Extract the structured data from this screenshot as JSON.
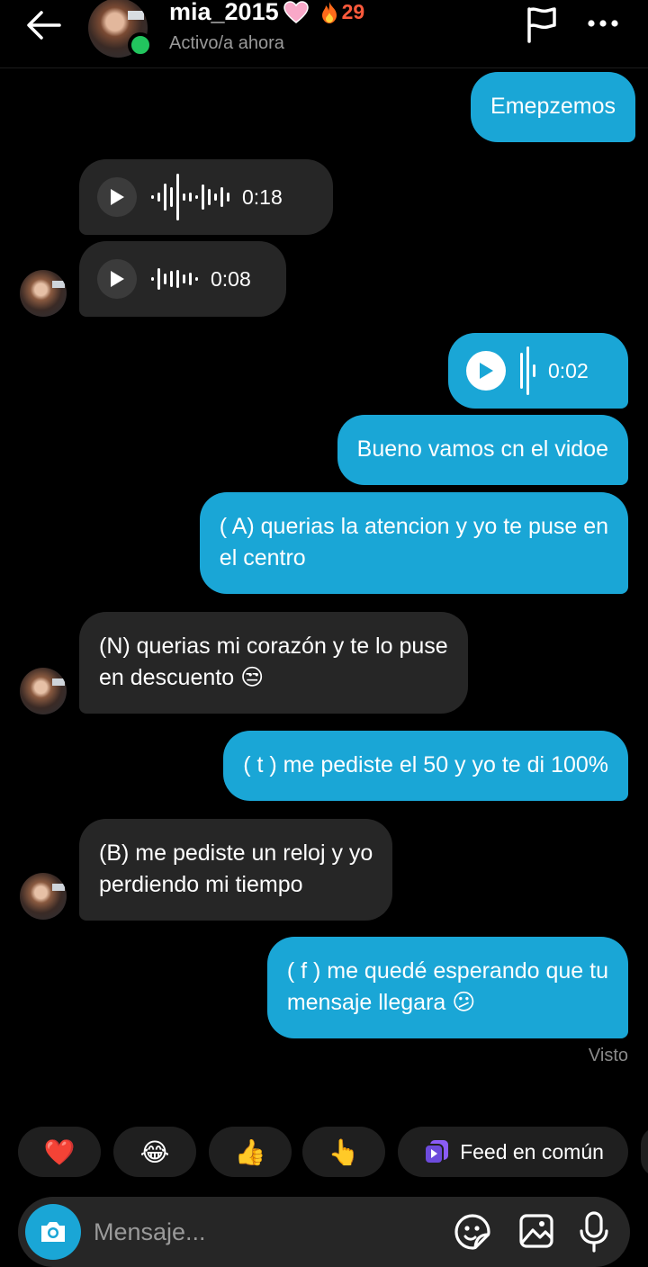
{
  "header": {
    "username": "mia_2015",
    "streak": "29",
    "status": "Activo/a ahora",
    "icons": [
      "back-arrow-icon",
      "heart-icon",
      "fire-icon",
      "flag-icon",
      "more-icon"
    ]
  },
  "messages": [
    {
      "side": "sent",
      "type": "text",
      "text": "Emepzemos"
    },
    {
      "side": "received",
      "type": "voice",
      "duration": "0:18"
    },
    {
      "side": "received",
      "type": "voice",
      "duration": "0:08"
    },
    {
      "side": "sent",
      "type": "voice",
      "duration": "0:02"
    },
    {
      "side": "sent",
      "type": "text",
      "text": "Bueno vamos cn el vidoe"
    },
    {
      "side": "sent",
      "type": "text",
      "text": "( A) querias la atencion y yo te puse en\nel centro"
    },
    {
      "side": "received",
      "type": "text",
      "text": "(N) querias mi corazón y te lo puse\nen descuento 😒"
    },
    {
      "side": "sent",
      "type": "text",
      "text": "( t ) me pediste el 50 y yo te di 100%"
    },
    {
      "side": "received",
      "type": "text",
      "text": "(B) me pediste un reloj y yo\nperdiendo mi tiempo"
    },
    {
      "side": "sent",
      "type": "text",
      "text": "( f ) me quedé esperando que tu\nmensaje llegara 😕"
    }
  ],
  "seen_label": "Visto",
  "reactions": {
    "emojis": [
      "❤️",
      "😂",
      "👍",
      "👆"
    ],
    "feed_label": "Feed en común"
  },
  "composer": {
    "placeholder": "Mensaje...",
    "icons": [
      "camera-icon",
      "sticker-icon",
      "gallery-icon",
      "mic-icon"
    ]
  },
  "colors": {
    "background": "#000000",
    "sent_bubble": "#1aa6d6",
    "received_bubble": "#262626",
    "online": "#22c55e",
    "streak": "#ff5a3c"
  }
}
